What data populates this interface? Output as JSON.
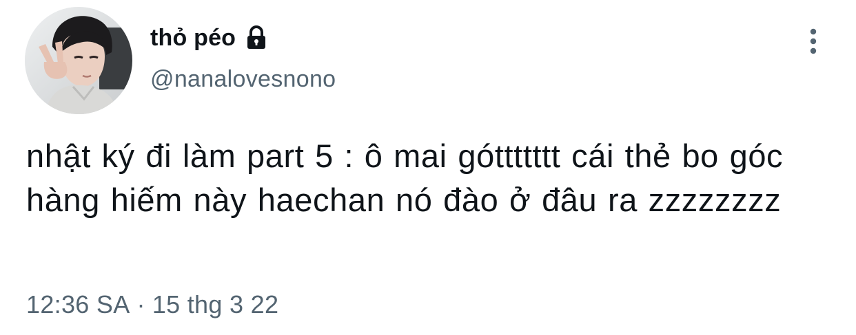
{
  "author": {
    "display_name": "thỏ péo",
    "handle": "@nanalovesnono",
    "protected_icon": "lock-icon",
    "avatar_icon": "profile-photo"
  },
  "tweet": {
    "text": "nhật ký đi làm part 5 : ô mai góttttttt cái thẻ bo góc hàng hiếm này haechan nó đào ở đâu ra zzzzzzzz",
    "time": "12:36 SA",
    "separator": "·",
    "date": "15 thg 3 22"
  },
  "actions": {
    "more_icon": "more-vertical-icon"
  },
  "colors": {
    "text_primary": "#0f1419",
    "text_secondary": "#536471",
    "background": "#ffffff"
  }
}
